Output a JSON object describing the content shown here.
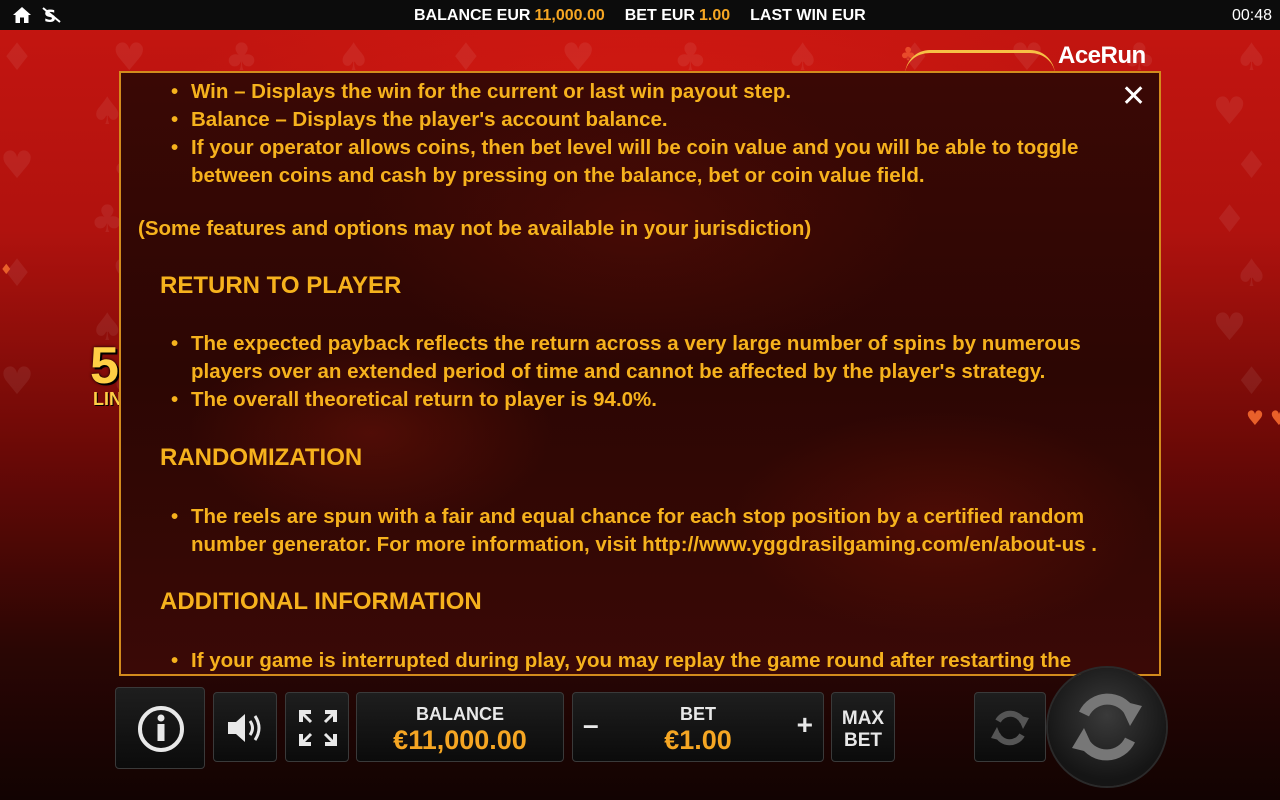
{
  "topbar": {
    "balance_label": "BALANCE EUR",
    "balance_value": "11,000.00",
    "bet_label": "BET EUR",
    "bet_value": "1.00",
    "last_win_label": "LAST WIN EUR",
    "clock": "00:48",
    "icons": [
      "home-icon",
      "responsible-gaming-icon"
    ]
  },
  "branding": {
    "logo": "AceRun",
    "partial_number": "5",
    "partial_label": "LIN"
  },
  "panel": {
    "bullets_top": [
      "Win – Displays the win for the current or last win payout step.",
      "Balance – Displays the player's account balance.",
      "If your operator allows coins, then bet level will be coin value and you will be able to toggle between coins and cash by pressing on the balance, bet or coin value field."
    ],
    "jurisdiction_note": "(Some features and options may not be available in your jurisdiction)",
    "rtp": {
      "heading": "RETURN TO PLAYER",
      "bullets": [
        "The expected payback reflects the return across a very large number of spins by numerous players over an extended period of time and cannot be affected by the player's strategy.",
        "The overall theoretical return to player is 94.0%."
      ]
    },
    "randomization": {
      "heading": "RANDOMIZATION",
      "bullets": [
        "The reels are spun with a fair and equal chance for each stop position by a certified random number generator. For more information, visit http://www.yggdrasilgaming.com/en/about-us ."
      ]
    },
    "additional": {
      "heading": "ADDITIONAL INFORMATION",
      "bullets": [
        "If your game is interrupted during play, you may replay the game round after restarting the game"
      ]
    },
    "close_icon": "close-icon"
  },
  "bottombar": {
    "balance_label": "BALANCE",
    "balance_value": "€11,000.00",
    "bet_label": "BET",
    "bet_value": "€1.00",
    "minus": "–",
    "plus": "+",
    "max_bet_line1": "MAX",
    "max_bet_line2": "BET",
    "icons": [
      "info-icon",
      "sound-icon",
      "fullscreen-icon",
      "autoplay-icon",
      "spin-icon"
    ]
  },
  "colors": {
    "accent": "#f6b21d",
    "value": "#f5a623",
    "panel_border": "#d38b1d"
  }
}
